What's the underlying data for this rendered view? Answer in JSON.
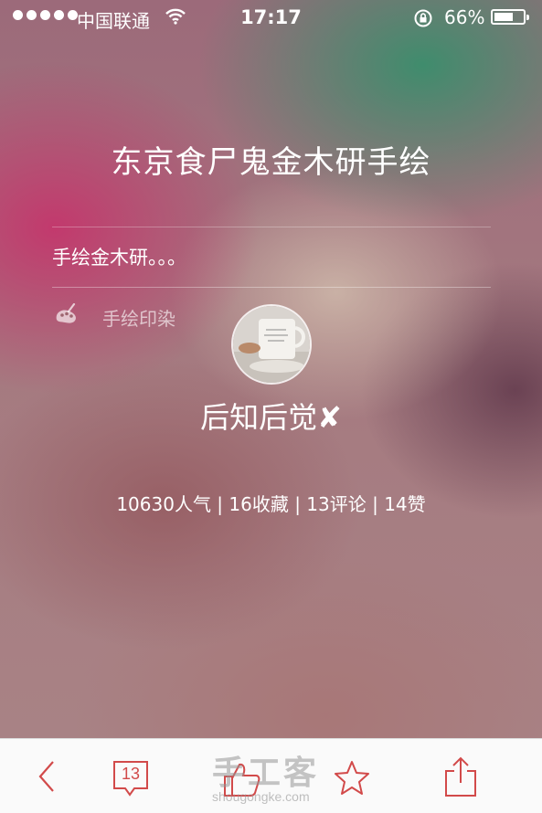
{
  "status_bar": {
    "carrier": "中国联通",
    "time": "17:17",
    "battery_percent_text": "66%",
    "battery_level": 0.66
  },
  "article": {
    "title": "东京食尸鬼金木研手绘",
    "description": "手绘金木研。。。",
    "category": "手绘印染"
  },
  "author": {
    "name": "后知后觉✘"
  },
  "stats": {
    "text": "10630人气 | 16收藏 | 13评论 | 14赞"
  },
  "toolbar": {
    "comment_count": "13",
    "accent_color": "#d24a4a"
  },
  "watermark": {
    "text": "手工客",
    "url": "shougongke.com"
  }
}
